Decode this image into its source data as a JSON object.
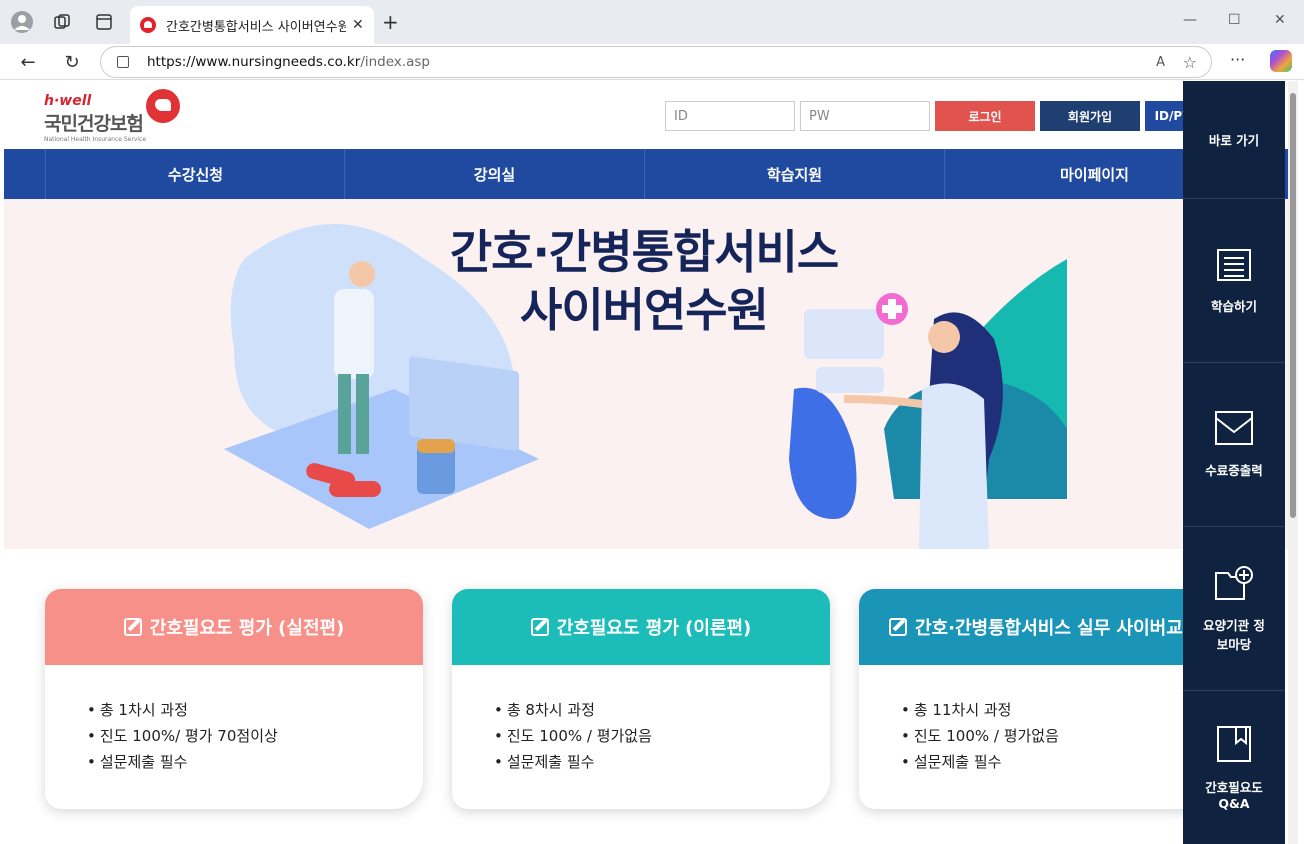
{
  "browser": {
    "tab_title": "간호간병통합서비스 사이버연수원",
    "url_host": "https://www.nursingneeds.co.kr",
    "url_path": "/index.asp"
  },
  "header": {
    "logo_top": "h·well",
    "logo_main": "국민건강보험",
    "logo_sub": "National Health Insurance Service",
    "id_placeholder": "ID",
    "pw_placeholder": "PW",
    "login": "로그인",
    "signup": "회원가입",
    "find": "ID/PW"
  },
  "gnb": [
    "수강신청",
    "강의실",
    "학습지원",
    "마이페이지"
  ],
  "hero": {
    "line1": "간호·간병통합서비스",
    "line2": "사이버연수원"
  },
  "cards": [
    {
      "title": "간호필요도 평가 (실전편)",
      "items": [
        "총 1차시 과정",
        "진도 100%/ 평가 70점이상",
        "설문제출 필수"
      ],
      "color": "#f79088"
    },
    {
      "title": "간호필요도 평가 (이론편)",
      "items": [
        "총 8차시 과정",
        "진도 100% / 평가없음",
        "설문제출 필수"
      ],
      "color": "#1cbdb8"
    },
    {
      "title": "간호·간병통합서비스 실무 사이버교육",
      "items": [
        "총 11차시 과정",
        "진도 100% / 평가없음",
        "설문제출 필수"
      ],
      "color": "#1a95b8"
    }
  ],
  "quick_menu": {
    "title": "바로 가기",
    "items": [
      {
        "label": "학습하기",
        "icon": "document-icon"
      },
      {
        "label": "수료증출력",
        "icon": "envelope-icon"
      },
      {
        "label": "요양기관 정보마당",
        "icon": "folder-plus-icon"
      },
      {
        "label": "간호필요도 Q&A",
        "icon": "bookmark-icon"
      }
    ]
  }
}
